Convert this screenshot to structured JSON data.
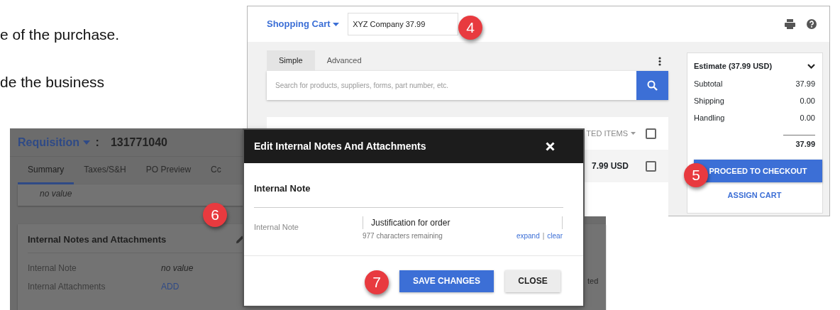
{
  "document_text": [
    "e of the purchase.",
    "de the business"
  ],
  "cart_window": {
    "title": "Shopping Cart",
    "cart_name": "XYZ Company 37.99",
    "callout": "4",
    "tabs": [
      {
        "label": "Simple",
        "selected": true
      },
      {
        "label": "Advanced",
        "selected": false
      }
    ],
    "search": {
      "placeholder": "Search for products, suppliers, forms, part number, etc."
    },
    "results": {
      "header": "TED ITEMS",
      "header_checked": false,
      "rows": [
        {
          "price": "7.99 USD",
          "checked": false
        }
      ]
    },
    "estimate": {
      "title": "Estimate (37.99 USD)",
      "lines": [
        {
          "label": "Subtotal",
          "value": "37.99"
        },
        {
          "label": "Shipping",
          "value": "0.00"
        },
        {
          "label": "Handling",
          "value": "0.00"
        }
      ],
      "total": "37.99",
      "primary_button": "PROCEED TO CHECKOUT",
      "callout": "5",
      "secondary_link": "ASSIGN CART"
    }
  },
  "requisition_window": {
    "title": "Requisition",
    "separator": ":",
    "number": "131771040",
    "tabs": [
      {
        "label": "Summary",
        "selected": true
      },
      {
        "label": "Taxes/S&H",
        "selected": false
      },
      {
        "label": "PO Preview",
        "selected": false
      },
      {
        "label": "Cc",
        "selected": false
      }
    ],
    "summary_value": "no value",
    "callout": "6",
    "section": {
      "title": "Internal Notes and Attachments",
      "fields": [
        {
          "label": "Internal Note",
          "value": "no value",
          "kind": "text"
        },
        {
          "label": "Internal Attachments",
          "value": "ADD",
          "kind": "link"
        }
      ]
    },
    "fragment": "ted"
  },
  "dialog": {
    "title": "Edit Internal Notes And Attachments",
    "section_title": "Internal Note",
    "field_label": "Internal Note",
    "value": "Justification for order",
    "helper": "977 characters remaining",
    "links": [
      "expand",
      "clear"
    ],
    "link_separator": "|",
    "callout": "7",
    "buttons": [
      {
        "label": "SAVE CHANGES",
        "kind": "primary"
      },
      {
        "label": "CLOSE",
        "kind": "secondary"
      }
    ]
  }
}
